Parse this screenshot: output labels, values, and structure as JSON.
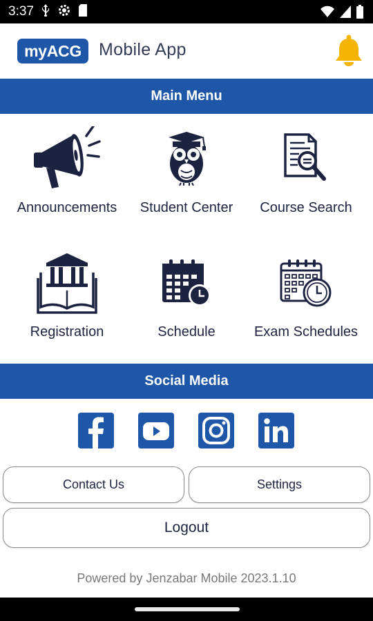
{
  "status_bar": {
    "time": "3:37",
    "left_icons": [
      "usb-icon",
      "settings-gear-icon",
      "sd-card-icon"
    ],
    "right_icons": [
      "wifi-icon",
      "cell-signal-icon",
      "battery-icon"
    ]
  },
  "header": {
    "logo_text": "myACG",
    "app_name": "Mobile App",
    "brand_color": "#1e56a8",
    "bell_color": "#f5b400",
    "bell_icon": "bell-icon"
  },
  "main_menu": {
    "title": "Main Menu",
    "tiles": [
      {
        "label": "Announcements",
        "icon": "megaphone-icon"
      },
      {
        "label": "Student Center",
        "icon": "owl-graduate-icon"
      },
      {
        "label": "Course Search",
        "icon": "document-search-icon"
      },
      {
        "label": "Registration",
        "icon": "library-book-icon"
      },
      {
        "label": "Schedule",
        "icon": "calendar-clock-icon"
      },
      {
        "label": "Exam Schedules",
        "icon": "calendar-clock-outline-icon"
      }
    ]
  },
  "social_media": {
    "title": "Social Media",
    "links": [
      "facebook-icon",
      "youtube-icon",
      "instagram-icon",
      "linkedin-icon"
    ]
  },
  "buttons": {
    "contact": "Contact Us",
    "settings": "Settings",
    "logout": "Logout"
  },
  "footer": {
    "powered_by": "Powered by Jenzabar Mobile 2023.1.10"
  }
}
